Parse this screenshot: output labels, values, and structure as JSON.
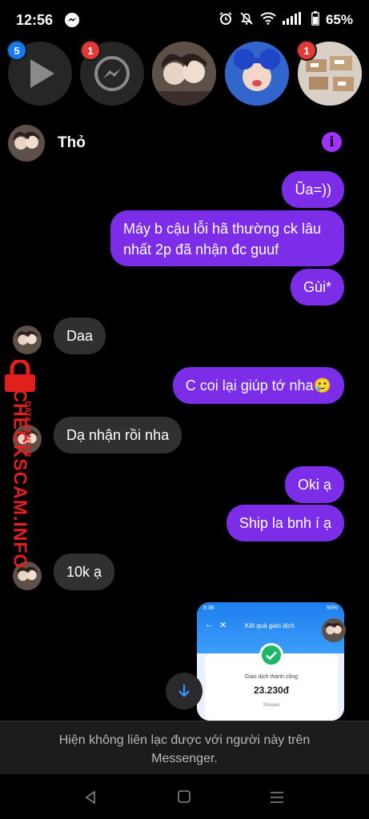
{
  "status_bar": {
    "time": "12:56",
    "battery": "65%"
  },
  "chat_heads": [
    {
      "name": "video",
      "badge": "5",
      "badge_color": "#1877f2"
    },
    {
      "name": "messenger",
      "badge": "1",
      "badge_color": "#e53935"
    },
    {
      "name": "tho"
    },
    {
      "name": "blue-hair"
    },
    {
      "name": "boxes",
      "badge": "1",
      "badge_color": "#e53935"
    }
  ],
  "header": {
    "name": "Thỏ"
  },
  "messages": [
    {
      "dir": "out",
      "text": "Ũa=))"
    },
    {
      "dir": "out",
      "text": "Máy b cậu lỗi hã thường ck lâu nhất 2p đã nhận đc guuf"
    },
    {
      "dir": "out",
      "text": "Gùi*"
    },
    {
      "dir": "in",
      "text": "Daa"
    },
    {
      "dir": "out",
      "text": "C coi lại giúp tớ nha🥲"
    },
    {
      "dir": "in",
      "text": "Dạ nhận rồi nha"
    },
    {
      "dir": "out",
      "text": "Oki ạ"
    },
    {
      "dir": "out",
      "text": "Ship la bnh í ạ"
    },
    {
      "dir": "in",
      "text": "10k ạ"
    }
  ],
  "attachment": {
    "status": "8:36",
    "battery": "93%",
    "title": "Kết quả giao dịch",
    "success": "Giao dịch thành công",
    "amount": "23.230đ",
    "merchant": "Shopee"
  },
  "footer": {
    "notice": "Hiện không liên lạc được với người này trên Messenger."
  },
  "watermark": {
    "title": "CHECKSCAM.INFO",
    "subtitle": "DATA CENTER"
  },
  "colors": {
    "outgoing": "#7b2de8",
    "incoming": "#303030",
    "accent": "#a033ff"
  }
}
